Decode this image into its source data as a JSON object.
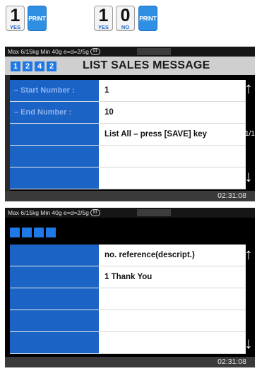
{
  "keys": {
    "k1": {
      "digit": "1",
      "sub": "YES"
    },
    "print1": "PRINT",
    "k2": {
      "digit": "1",
      "sub": "YES"
    },
    "k3": {
      "digit": "0",
      "sub": "NO"
    },
    "print2": "PRINT"
  },
  "screen1": {
    "status": "Max 6/15kg Min 40g e=d=2/5g",
    "status_badge": "III",
    "codes": [
      "1",
      "2",
      "4",
      "2"
    ],
    "title": "LIST SALES MESSAGE",
    "rows": [
      {
        "label": "– Start Number :",
        "value": "1"
      },
      {
        "label": "– End Number  :",
        "value": "10"
      },
      {
        "label": "",
        "value": "List All – press [SAVE] key"
      },
      {
        "label": "",
        "value": ""
      },
      {
        "label": "",
        "value": ""
      }
    ],
    "page_indicator": "1/1",
    "clock": "02:31:08"
  },
  "screen2": {
    "status": "Max 6/15kg Min 40g e=d=2/5g",
    "status_badge": "III",
    "rows": [
      {
        "label": "",
        "value": "no. reference(descript.)"
      },
      {
        "label": "",
        "value": "1 Thank You"
      },
      {
        "label": "",
        "value": ""
      },
      {
        "label": "",
        "value": ""
      },
      {
        "label": "",
        "value": ""
      }
    ],
    "clock": "02:31:08"
  },
  "icons": {
    "scroll_up": "up-arrow-icon",
    "scroll_down": "down-arrow-icon"
  },
  "colors": {
    "accent_blue": "#1c63c6",
    "key_blue": "#2f8fe3"
  }
}
